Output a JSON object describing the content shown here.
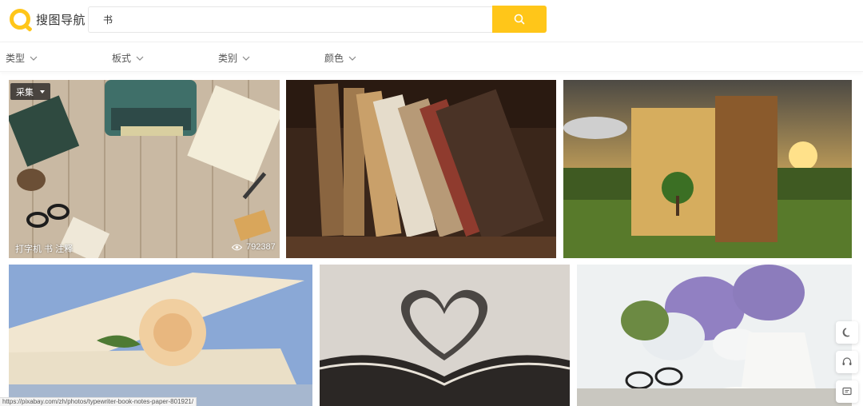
{
  "header": {
    "logo_text": "搜图导航",
    "search_value": "书",
    "search_icon": "search-icon"
  },
  "filters": [
    {
      "label": "类型"
    },
    {
      "label": "板式"
    },
    {
      "label": "类别"
    },
    {
      "label": "颜色"
    }
  ],
  "cards": [
    {
      "badge": "采集",
      "caption": "打字机 书 注释",
      "views": "792387",
      "subject": "typewriter-notebook-desk"
    },
    {
      "subject": "old-books-on-shelf"
    },
    {
      "subject": "giant-book-landscape-sunset"
    },
    {
      "subject": "rose-on-open-book"
    },
    {
      "subject": "heart-shaped-book-pages"
    },
    {
      "subject": "lilac-flowers-glasses-teacup"
    }
  ],
  "side_tools": [
    {
      "icon": "moon-icon"
    },
    {
      "icon": "headset-icon"
    },
    {
      "icon": "message-icon"
    }
  ],
  "status_url": "https://pixabay.com/zh/photos/typewriter-book-notes-paper-801921/",
  "colors": {
    "accent": "#ffc619"
  }
}
